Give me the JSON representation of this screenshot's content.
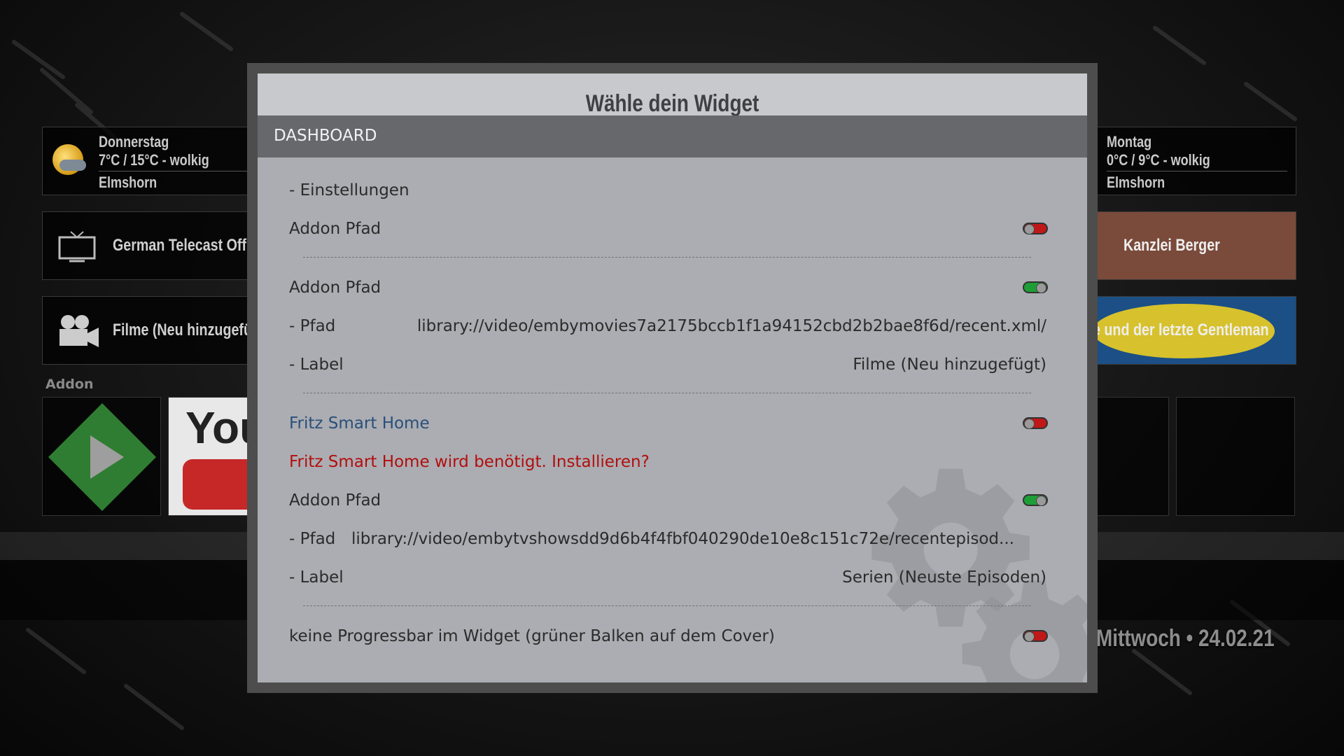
{
  "background": {
    "weather": [
      {
        "day": "Donnerstag",
        "temp": "7°C / 15°C - wolkig",
        "location": "Elmshorn"
      },
      {
        "day": "Montag",
        "temp": "0°C / 9°C - wolkig",
        "location": "Elmshorn"
      }
    ],
    "shortcuts": {
      "tv_label": "German Telecast Off",
      "movies_label": "Filme (Neu hinzugefü",
      "right_top_label": "Kanzlei Berger",
      "right_mid_label": "e und der letzte Gentleman"
    },
    "addon_header": "Addon",
    "clock": "Mittwoch • 24.02.21"
  },
  "dialog": {
    "title": "Wähle dein Widget",
    "tab": "DASHBOARD",
    "rows": {
      "settings": "- Einstellungen",
      "addon1": "Addon Pfad",
      "addon2": "Addon Pfad",
      "path1_label": "- Pfad",
      "path1_value": "library://video/embymovies7a2175bccb1f1a94152cbd2b2bae8f6d/recent.xml/",
      "label1_label": "- Label",
      "label1_value": "Filme (Neu hinzugefügt)",
      "fritz": "Fritz Smart Home",
      "fritz_warn": "Fritz Smart Home wird benötigt. Installieren?",
      "addon3": "Addon Pfad",
      "path2_label": "- Pfad",
      "path2_value": "library://video/embytvshowsdd9d6b4f4fbf040290de10e8c151c72e/recentepisod...",
      "label2_label": "- Label",
      "label2_value": "Serien (Neuste Episoden)",
      "progressbar": "keine Progressbar im Widget (grüner Balken auf dem Cover)"
    },
    "toggles": {
      "addon1": "off",
      "addon2": "on",
      "fritz": "off",
      "addon3": "on",
      "progressbar": "off"
    }
  }
}
